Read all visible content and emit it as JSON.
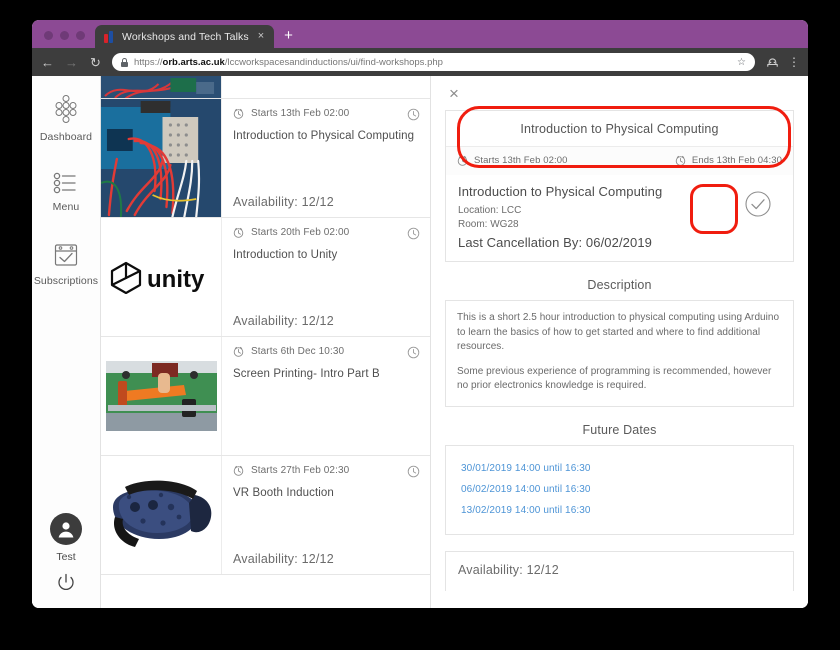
{
  "browser": {
    "tab_title": "Workshops and Tech Talks",
    "tab_close": "×",
    "new_tab": "+",
    "back": "←",
    "forward": "→",
    "reload": "↻",
    "url_prefix": "https://",
    "url_domain": "orb.arts.ac.uk",
    "url_path": "/lccworkspacesandinductions/ui/find-workshops.php",
    "star": "☆",
    "menu": "⋮"
  },
  "sidebar": {
    "items": [
      {
        "label": "Dashboard",
        "icon": "dashboard-icon"
      },
      {
        "label": "Menu",
        "icon": "list-icon"
      },
      {
        "label": "Subscriptions",
        "icon": "calendar-check-icon"
      }
    ],
    "user": "Test",
    "power_icon": "power-icon"
  },
  "list": {
    "cards": [
      {
        "starts": "Starts 13th Feb 02:00",
        "title": "Introduction to Physical Computing",
        "availability": "Availability: 12/12",
        "thumb": "arduino-photo"
      },
      {
        "starts": "Starts 20th Feb 02:00",
        "title": "Introduction to Unity",
        "availability": "Availability: 12/12",
        "thumb": "unity-logo"
      },
      {
        "starts": "Starts 6th Dec 10:30",
        "title": "Screen Printing- Intro Part B",
        "availability": "",
        "thumb": "screenprint-photo"
      },
      {
        "starts": "Starts 27th Feb 02:30",
        "title": "VR Booth Induction",
        "availability": "Availability: 12/12",
        "thumb": "vr-headset-photo"
      }
    ]
  },
  "detail": {
    "close_label": "×",
    "header_title": "Introduction to Physical Computing",
    "starts": "Starts 13th Feb 02:00",
    "ends": "Ends 13th Feb 04:30",
    "body_title": "Introduction to Physical Computing",
    "location": "Location: LCC",
    "room": "Room: WG28",
    "last_cancellation": "Last Cancellation By: 06/02/2019",
    "booked_icon": "circle-check-icon",
    "description_heading": "Description",
    "description_p1": "This is a short 2.5 hour introduction to physical computing using Arduino to learn the basics of how to get started and where to find additional resources.",
    "description_p2": "Some previous experience of programming is recommended, however no prior electronics knowledge is required.",
    "future_dates_heading": "Future Dates",
    "future_dates": [
      "30/01/2019 14:00 until 16:30",
      "06/02/2019 14:00 until 16:30",
      "13/02/2019 14:00 until 16:30"
    ],
    "availability": "Availability: 12/12"
  },
  "annotations": {
    "color": "#f01d0f",
    "shapes": [
      {
        "name": "header-highlight",
        "target": "detail header and times"
      },
      {
        "name": "booked-check-highlight",
        "target": "circle check icon"
      }
    ]
  }
}
